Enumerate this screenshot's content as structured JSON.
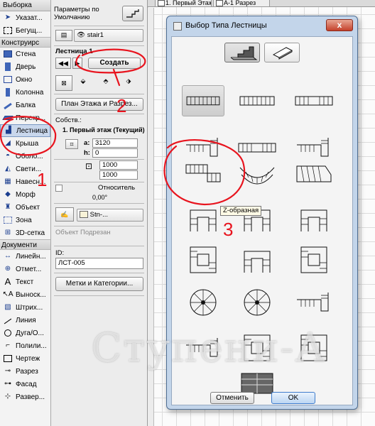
{
  "toolbox": {
    "header": "Выборка",
    "items_top": [
      {
        "label": "Указат..."
      },
      {
        "label": "Бегущ..."
      }
    ],
    "group_design": "Конструирс",
    "items_design": [
      {
        "label": "Стена"
      },
      {
        "label": "Дверь"
      },
      {
        "label": "Окно"
      },
      {
        "label": "Колонна"
      },
      {
        "label": "Балка"
      },
      {
        "label": "Перекр..."
      },
      {
        "label": "Лестница"
      },
      {
        "label": "Крыша"
      },
      {
        "label": "Оболо..."
      },
      {
        "label": "Свети..."
      },
      {
        "label": "Навесн..."
      },
      {
        "label": "Морф"
      },
      {
        "label": "Объект"
      },
      {
        "label": "Зона"
      },
      {
        "label": "3D-сетка"
      }
    ],
    "group_document": "Документи",
    "items_document": [
      {
        "label": "Линейн..."
      },
      {
        "label": "Отмет..."
      },
      {
        "label": "Текст"
      },
      {
        "label": "Выноск..."
      },
      {
        "label": "Штрих..."
      },
      {
        "label": "Линия"
      },
      {
        "label": "Дуга/О..."
      },
      {
        "label": "Полили..."
      },
      {
        "label": "Чертеж"
      },
      {
        "label": "Разрез"
      },
      {
        "label": "Фасад"
      },
      {
        "label": "Развер..."
      }
    ]
  },
  "infobox": {
    "params_label": "Параметры по Умолчанию",
    "layer_value": "stair1",
    "tool_name": "Лестница 1",
    "create_button": "Создать",
    "floor_plan_button": "План Этажа и Разрез...",
    "floor_label": "Собств.:",
    "floor_value": "1. Первый этаж (Текущий)",
    "dim_a": "3120",
    "dim_b": "0",
    "dim_c": "1000",
    "dim_d": "1000",
    "relative_label": "Относитель",
    "angle_value": "0,00°",
    "pen_value": "Stn-...",
    "cut_object_label": "Объект Подрезан",
    "id_label": "ID:",
    "id_value": "ЛСТ-005",
    "labels_button": "Метки и Категории..."
  },
  "drawing": {
    "tabs": [
      "1. Первый Этаж",
      "A-1 Разрез"
    ]
  },
  "dialog": {
    "title": "Выбор Типа Лестницы",
    "close_glyph": "x",
    "tooltip": "Z-образная",
    "cancel_button": "Отменить",
    "ok_button": "OK"
  },
  "annotations": [
    "1",
    "2",
    "3"
  ],
  "watermark": "Ступени-А",
  "colors": {
    "selection": "#c9d7ec",
    "dialog_frame": "#c3d5ea",
    "close_button": "#c4402a",
    "annotation_red": "#e8141e"
  }
}
